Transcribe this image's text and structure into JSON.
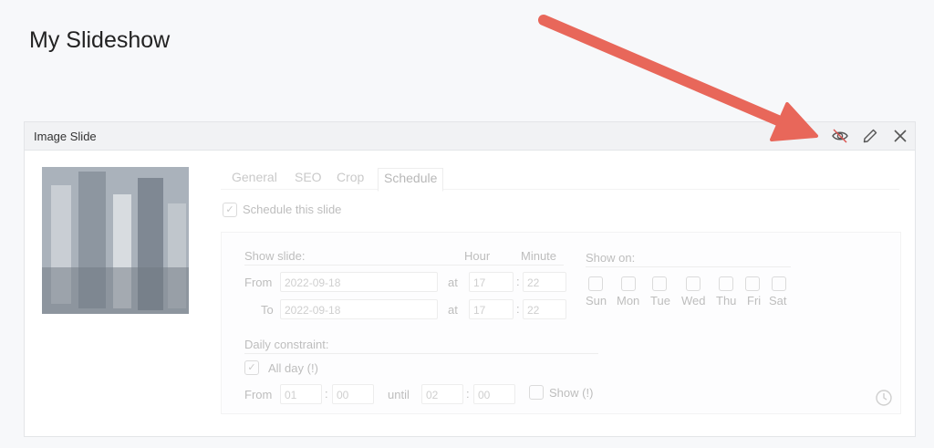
{
  "page": {
    "title": "My Slideshow"
  },
  "panel": {
    "title": "Image Slide",
    "icons": [
      "eye-slash-icon",
      "pencil-icon",
      "close-icon"
    ]
  },
  "tabs": [
    "General",
    "SEO",
    "Crop",
    "Schedule"
  ],
  "schedule": {
    "checkbox_label": "Schedule this slide",
    "show_slide": "Show slide:",
    "hour": "Hour",
    "minute": "Minute",
    "from_label": "From",
    "to_label": "To",
    "from_date": "2022-09-18",
    "to_date": "2022-09-18",
    "at": "at",
    "from_hour": "17",
    "from_minute": "22",
    "to_hour": "17",
    "to_minute": "22",
    "colon": ":",
    "show_on": "Show on:",
    "days": [
      "Sun",
      "Mon",
      "Tue",
      "Wed",
      "Thu",
      "Fri",
      "Sat"
    ],
    "daily_constraint": "Daily constraint:",
    "all_day": "All day (!)",
    "daily_from": "From",
    "daily_from_hour": "01",
    "daily_from_min": "00",
    "until": "until",
    "daily_until_hour": "02",
    "daily_until_min": "00",
    "show_label": "Show (!)"
  },
  "colors": {
    "arrow": "#e8675a"
  }
}
